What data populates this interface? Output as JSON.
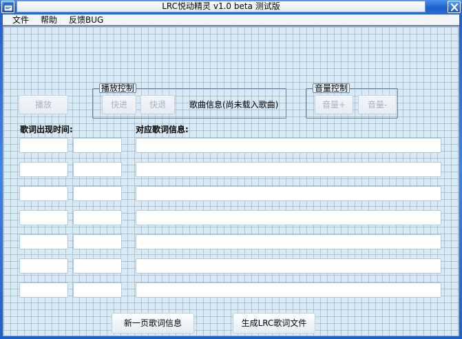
{
  "window": {
    "title": "LRC悦动精灵  v1.0 beta 测试版"
  },
  "menu": {
    "items": [
      {
        "label": "文件"
      },
      {
        "label": "帮助"
      },
      {
        "label": "反馈BUG"
      }
    ]
  },
  "controls": {
    "play_label": "播放",
    "playback_group": {
      "label": "播放控制",
      "forward_label": "快进",
      "rewind_label": "快退"
    },
    "song_info": "歌曲信息(尚未载入歌曲)",
    "volume_group": {
      "label": "音量控制",
      "vol_up_label": "音量+",
      "vol_down_label": "音量-"
    }
  },
  "lyrics": {
    "time_header": "歌词出现时间:",
    "text_header": "对应歌词信息:",
    "rows": [
      {
        "time_a": "",
        "time_b": "",
        "text": ""
      },
      {
        "time_a": "",
        "time_b": "",
        "text": ""
      },
      {
        "time_a": "",
        "time_b": "",
        "text": ""
      },
      {
        "time_a": "",
        "time_b": "",
        "text": ""
      },
      {
        "time_a": "",
        "time_b": "",
        "text": ""
      },
      {
        "time_a": "",
        "time_b": "",
        "text": ""
      },
      {
        "time_a": "",
        "time_b": "",
        "text": ""
      }
    ]
  },
  "footer": {
    "new_page_label": "新一页歌词信息",
    "generate_label": "生成LRC歌词文件"
  },
  "icons": {
    "app_icon": "app-icon",
    "close_icon": "close-icon"
  },
  "colors": {
    "frame": "#2a6fd0",
    "grid_bg": "#d7eaf6",
    "grid_line": "#78aacd"
  }
}
